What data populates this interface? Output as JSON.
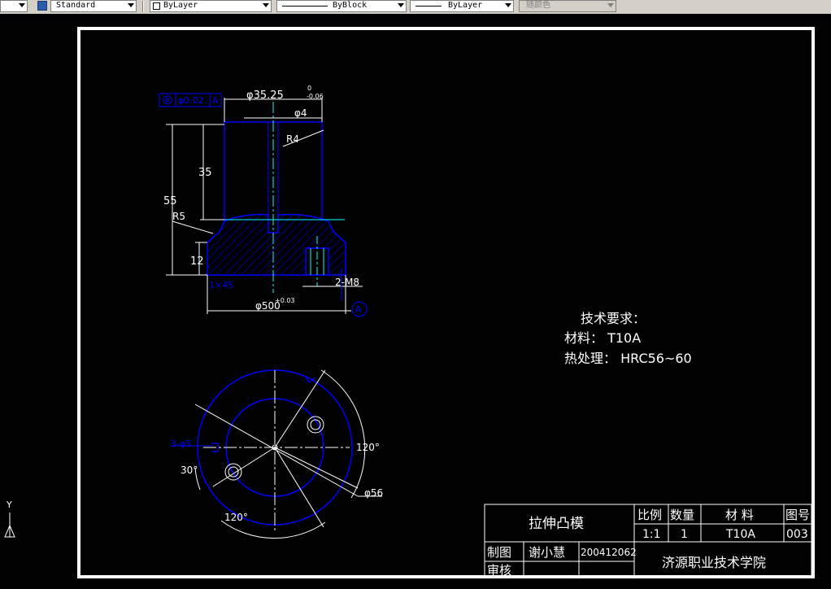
{
  "toolbar": {
    "text_style": "Standard",
    "layer_color": "ByLayer",
    "linetype": "ByBlock",
    "lineweight": "ByLayer",
    "plot_style": "随颜色"
  },
  "drawing": {
    "tech_req": {
      "title": "技术要求：",
      "material": "材料： T10A",
      "heat_treat": "热处理： HRC56~60"
    },
    "dims": {
      "d_top": "φ35.25",
      "d_top_tol_up": "0",
      "d_top_tol_dn": "-0.06",
      "d4": "φ4",
      "r4": "R4",
      "h35": "35",
      "h55": "55",
      "r5": "R5",
      "h12": "12",
      "chamfer": "1×45",
      "m8": "2-M8",
      "d500": "φ500",
      "d500_tol": "+0.03",
      "datum": "A",
      "fcf_tol": "φ0.02",
      "fcf_datum": "A",
      "holes": "3-φ5",
      "a30": "30°",
      "a120_right": "120°",
      "a120_bottom": "120°",
      "d56": "φ56"
    },
    "title_block": {
      "part_name": "拉伸凸模",
      "h_scale": "比例",
      "h_qty": "数量",
      "h_material": "材 料",
      "h_drawing_no": "图号",
      "scale": "1:1",
      "qty": "1",
      "material": "T10A",
      "drawing_no": "003",
      "drawn_by_label": "制图",
      "drawn_by": "谢小慧",
      "student_id": "200412062",
      "checked_by_label": "审核",
      "school": "济源职业技术学院"
    },
    "ucs": {
      "y": "Y"
    }
  }
}
